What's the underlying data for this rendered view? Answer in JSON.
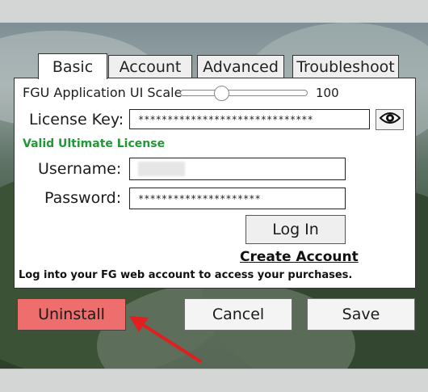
{
  "tabs": [
    {
      "label": "Basic"
    },
    {
      "label": "Account"
    },
    {
      "label": "Advanced"
    },
    {
      "label": "Troubleshoot"
    }
  ],
  "ui_scale": {
    "label": "FGU Application UI Scale",
    "value": "100",
    "level_percent": 30
  },
  "license": {
    "label": "License Key:",
    "value": "******************************",
    "status": "Valid Ultimate License",
    "status_color": "#1e9a34"
  },
  "username": {
    "label": "Username:",
    "value": ""
  },
  "password": {
    "label": "Password:",
    "value": "*********************"
  },
  "login_button": "Log In",
  "create_account_link": "Create Account",
  "info_text": "Log into your FG web account to access your purchases.",
  "buttons": {
    "uninstall": "Uninstall",
    "cancel": "Cancel",
    "save": "Save"
  },
  "colors": {
    "uninstall_bg": "#ee6d6d",
    "annotation_arrow": "#e02020"
  },
  "icons": {
    "reveal_password": "eye-icon"
  }
}
